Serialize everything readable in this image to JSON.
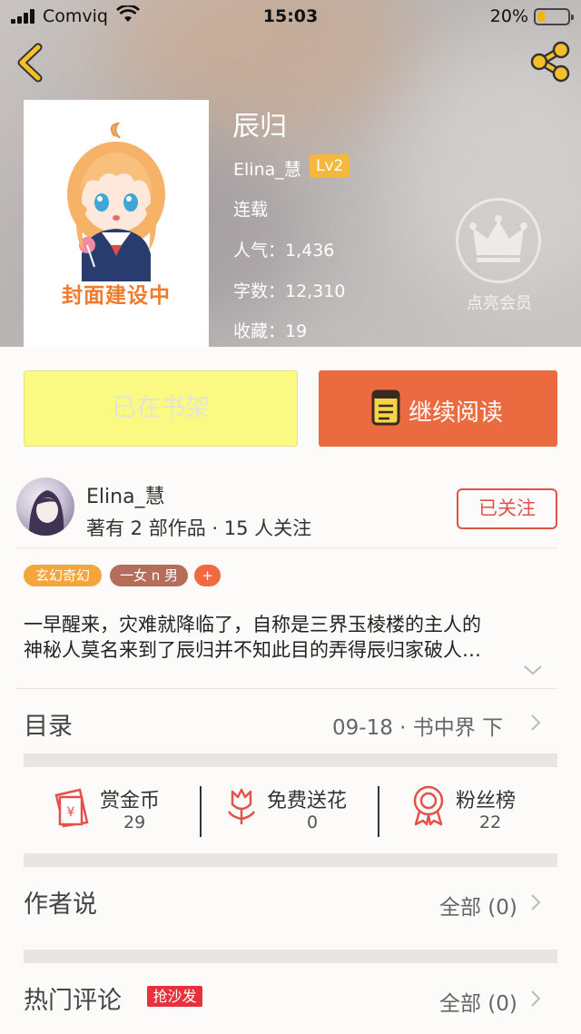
{
  "status_bar": {
    "carrier": "Comviq",
    "time": "15:03",
    "battery": "20%"
  },
  "book": {
    "title": "辰归",
    "cover_caption": "封面建设中",
    "author": "Elina_慧",
    "level": "Lv2",
    "status": "连载",
    "popularity": "人气：1,436",
    "word_count": "字数：12,310",
    "favorites": "收藏：19"
  },
  "vip": {
    "label": "点亮会员"
  },
  "actions": {
    "shelf_label": "已在书架",
    "read_label": "继续阅读"
  },
  "author_info": {
    "name": "Elina_慧",
    "stats": "著有 2 部作品 · 15 人关注",
    "follow_label": "已关注"
  },
  "tags": [
    "玄幻奇幻",
    "一女 n 男",
    "+"
  ],
  "description": {
    "line1": "一早醒来，灾难就降临了，自称是三界玉棱楼的主人的",
    "line2": "神秘人莫名来到了辰归并不知此目的弄得辰归家破人…"
  },
  "catalog": {
    "label": "目录",
    "latest": "09-18 · 书中界 下"
  },
  "stats": [
    {
      "label": "赏金币",
      "value": "29"
    },
    {
      "label": "免费送花",
      "value": "0"
    },
    {
      "label": "粉丝榜",
      "value": "22"
    }
  ],
  "author_says": {
    "label": "作者说",
    "link": "全部 (0)"
  },
  "hot_comments": {
    "label": "热门评论",
    "badge": "抢沙发",
    "link": "全部 (0)"
  },
  "colors": {
    "accent_orange": "#ec6a3f",
    "shelf_yellow": "#fafa82",
    "follow_red": "#e2524a",
    "badge_red": "#e5323d",
    "level_gold": "#f5b83d"
  }
}
